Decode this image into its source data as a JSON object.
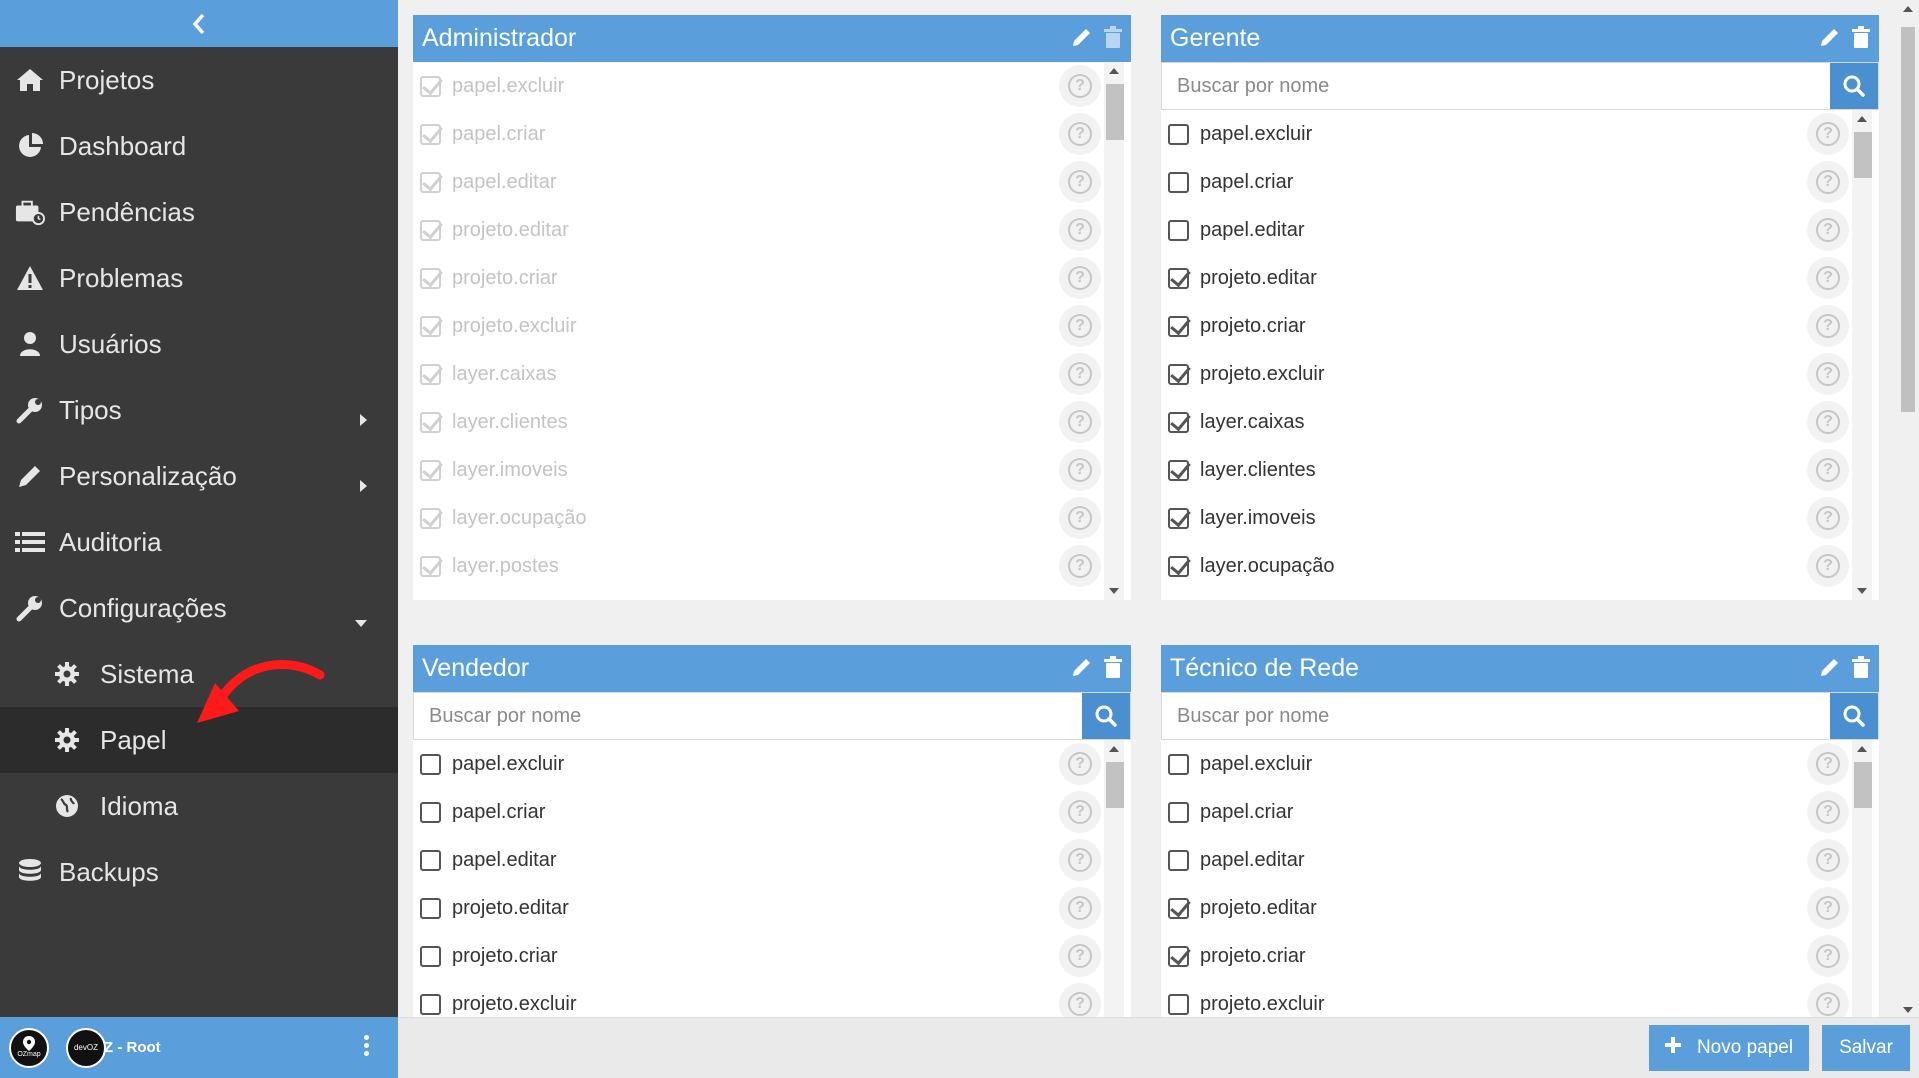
{
  "sidebar": {
    "items": [
      {
        "label": "Projetos",
        "icon": "home-icon"
      },
      {
        "label": "Dashboard",
        "icon": "pie-chart-icon"
      },
      {
        "label": "Pendências",
        "icon": "briefcase-clock-icon"
      },
      {
        "label": "Problemas",
        "icon": "warning-icon"
      },
      {
        "label": "Usuários",
        "icon": "user-icon"
      },
      {
        "label": "Tipos",
        "icon": "wrench-icon"
      },
      {
        "label": "Personalização",
        "icon": "pencil-icon"
      },
      {
        "label": "Auditoria",
        "icon": "list-icon"
      },
      {
        "label": "Configurações",
        "icon": "wrench-icon"
      },
      {
        "label": "Sistema",
        "icon": "gear-icon"
      },
      {
        "label": "Papel",
        "icon": "gear-icon"
      },
      {
        "label": "Idioma",
        "icon": "globe-icon"
      },
      {
        "label": "Backups",
        "icon": "database-icon"
      }
    ],
    "footer": {
      "name": "Z - Root",
      "avatar1": "OZmap",
      "avatar2": "devOZ"
    }
  },
  "panels": [
    {
      "title": "Administrador",
      "permissions": [
        {
          "label": "papel.excluir",
          "checked": true
        },
        {
          "label": "papel.criar",
          "checked": true
        },
        {
          "label": "papel.editar",
          "checked": true
        },
        {
          "label": "projeto.editar",
          "checked": true
        },
        {
          "label": "projeto.criar",
          "checked": true
        },
        {
          "label": "projeto.excluir",
          "checked": true
        },
        {
          "label": "layer.caixas",
          "checked": true
        },
        {
          "label": "layer.clientes",
          "checked": true
        },
        {
          "label": "layer.imoveis",
          "checked": true
        },
        {
          "label": "layer.ocupação",
          "checked": true
        },
        {
          "label": "layer.postes",
          "checked": true
        }
      ]
    },
    {
      "title": "Gerente",
      "search_placeholder": "Buscar por nome",
      "permissions": [
        {
          "label": "papel.excluir",
          "checked": false
        },
        {
          "label": "papel.criar",
          "checked": false
        },
        {
          "label": "papel.editar",
          "checked": false
        },
        {
          "label": "projeto.editar",
          "checked": true
        },
        {
          "label": "projeto.criar",
          "checked": true
        },
        {
          "label": "projeto.excluir",
          "checked": true
        },
        {
          "label": "layer.caixas",
          "checked": true
        },
        {
          "label": "layer.clientes",
          "checked": true
        },
        {
          "label": "layer.imoveis",
          "checked": true
        },
        {
          "label": "layer.ocupação",
          "checked": true
        }
      ]
    },
    {
      "title": "Vendedor",
      "search_placeholder": "Buscar por nome",
      "permissions": [
        {
          "label": "papel.excluir",
          "checked": false
        },
        {
          "label": "papel.criar",
          "checked": false
        },
        {
          "label": "papel.editar",
          "checked": false
        },
        {
          "label": "projeto.editar",
          "checked": false
        },
        {
          "label": "projeto.criar",
          "checked": false
        },
        {
          "label": "projeto.excluir",
          "checked": false
        }
      ]
    },
    {
      "title": "Técnico de Rede",
      "search_placeholder": "Buscar por nome",
      "permissions": [
        {
          "label": "papel.excluir",
          "checked": false
        },
        {
          "label": "papel.criar",
          "checked": false
        },
        {
          "label": "papel.editar",
          "checked": false
        },
        {
          "label": "projeto.editar",
          "checked": true
        },
        {
          "label": "projeto.criar",
          "checked": true
        },
        {
          "label": "projeto.excluir",
          "checked": false
        }
      ]
    }
  ],
  "actions": {
    "new_role": "Novo papel",
    "save": "Salvar"
  },
  "help_glyph": "?",
  "colors": {
    "accent": "#5a9fdc",
    "sidebar_bg": "#3a3a3a",
    "annotation_arrow": "#ff1a1a"
  }
}
